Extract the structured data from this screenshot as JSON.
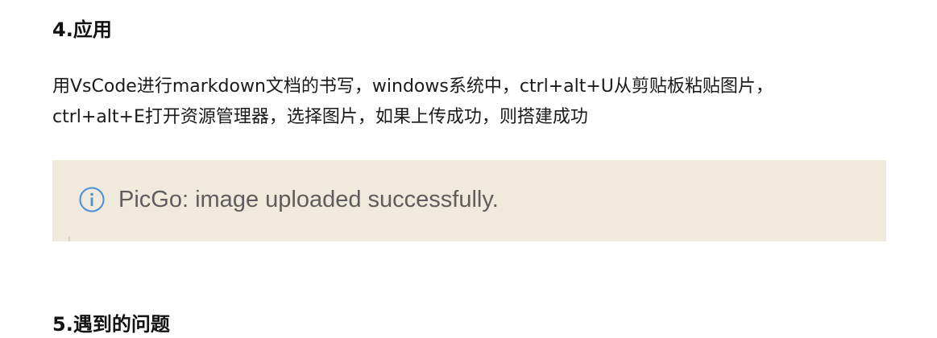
{
  "section_heading": "4.应用",
  "paragraph": {
    "line1": "用VsCode进行markdown文档的书写，windows系统中，ctrl+alt+U从剪贴板粘贴图片，",
    "line2": "ctrl+alt+E打开资源管理器，选择图片，如果上传成功，则搭建成功"
  },
  "screenshot": {
    "icon": "info-circle-icon",
    "message": "PicGo: image uploaded successfully.",
    "background_color": "#efeadb",
    "icon_color": "#4a90d9"
  },
  "next_heading": "5.遇到的问题"
}
